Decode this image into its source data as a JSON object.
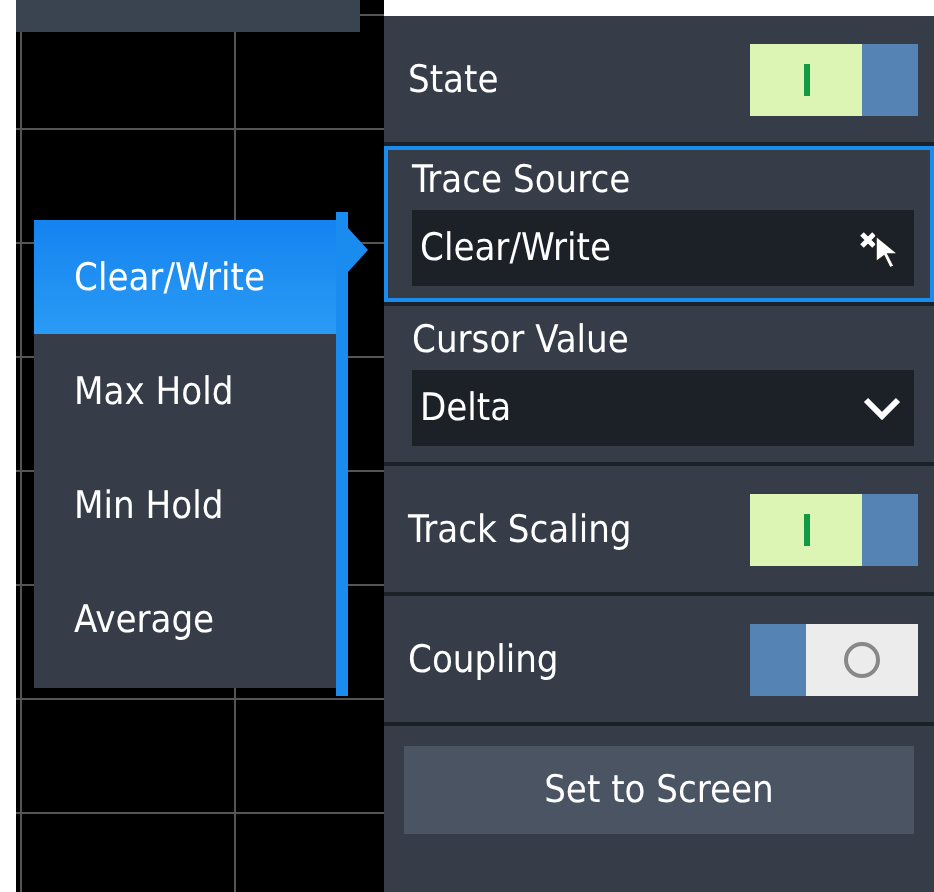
{
  "trace_menu": {
    "items": [
      {
        "label": "Clear/Write",
        "selected": true
      },
      {
        "label": "Max Hold",
        "selected": false
      },
      {
        "label": "Min Hold",
        "selected": false
      },
      {
        "label": "Average",
        "selected": false
      }
    ]
  },
  "settings": [
    {
      "kind": "toggle",
      "label": "State",
      "on": true
    },
    {
      "kind": "dropdown",
      "label": "Trace Source",
      "value": "Clear/Write",
      "focused": true
    },
    {
      "kind": "dropdown",
      "label": "Cursor Value",
      "value": "Delta",
      "focused": false
    },
    {
      "kind": "toggle",
      "label": "Track Scaling",
      "on": true
    },
    {
      "kind": "toggle",
      "label": "Coupling",
      "on": false
    },
    {
      "kind": "button",
      "label": "Set to Screen"
    }
  ]
}
